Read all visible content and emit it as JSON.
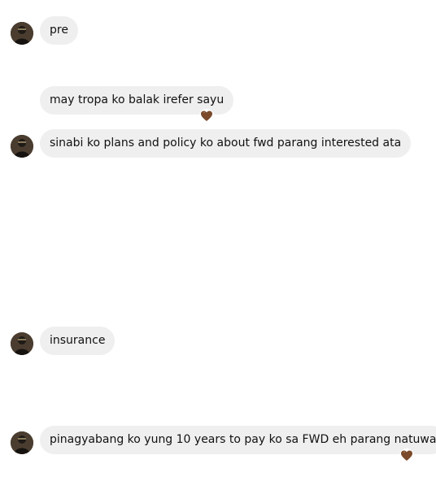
{
  "theme": {
    "bubble_bg": "#efefef",
    "text": "#111111",
    "reaction_color": "#7a4a2a"
  },
  "messages": [
    {
      "text": "pre",
      "avatar": true,
      "reaction": null
    },
    {
      "text": "may tropa ko balak irefer sayu",
      "avatar": false,
      "reaction": "brown-heart-icon"
    },
    {
      "text": "sinabi ko plans and policy ko about fwd parang interested ata",
      "avatar": true,
      "reaction": null
    },
    {
      "text": "insurance",
      "avatar": true,
      "reaction": null
    },
    {
      "text": "pinagyabang ko yung 10 years to pay ko sa FWD eh parang natuwa",
      "avatar": true,
      "reaction": "brown-heart-icon"
    }
  ]
}
